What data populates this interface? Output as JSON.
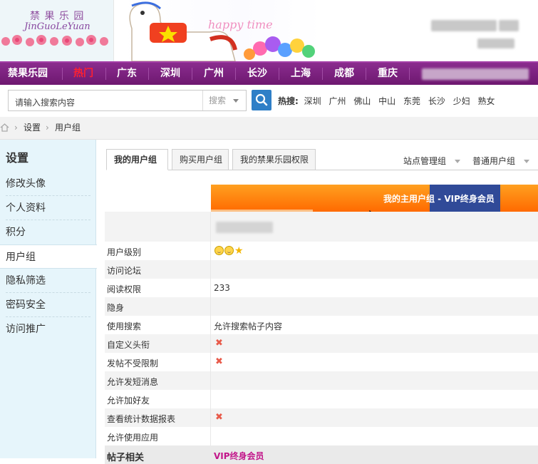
{
  "header": {
    "logo_cn": "禁 果 乐 园",
    "logo_en": "JinGuoLeYuan",
    "tagline": "happy time"
  },
  "nav": {
    "items": [
      "禁果乐园",
      "热门",
      "广东",
      "深圳",
      "广州",
      "长沙",
      "上海",
      "成都",
      "重庆"
    ],
    "hot_color": "#ff2030"
  },
  "search": {
    "placeholder": "请输入搜索内容",
    "type": "搜索",
    "hot_label": "热搜:",
    "hot_words": [
      "深圳",
      "广州",
      "佛山",
      "中山",
      "东莞",
      "长沙",
      "少妇",
      "熟女"
    ]
  },
  "breadcrumb": [
    "设置",
    "用户组"
  ],
  "sidebar": {
    "title": "设置",
    "items": [
      "修改头像",
      "个人资料",
      "积分",
      "用户组",
      "隐私筛选",
      "密码安全",
      "访问推广"
    ],
    "active": "用户组"
  },
  "tabs": {
    "items": [
      "我的用户组",
      "购买用户组",
      "我的禁果乐园权限"
    ],
    "active": "我的用户组",
    "right_dropdowns": [
      "站点管理组",
      "普通用户组"
    ]
  },
  "group": {
    "main_label": "我的主用户组 - VIP终身会员",
    "accent": "#ff7a10",
    "vip_color": "#304a98"
  },
  "permissions": [
    {
      "label": "用户级别",
      "value": "",
      "icon": "level"
    },
    {
      "label": "访问论坛",
      "value": ""
    },
    {
      "label": "阅读权限",
      "value": "233"
    },
    {
      "label": "隐身",
      "value": ""
    },
    {
      "label": "使用搜索",
      "value": "允许搜索帖子内容"
    },
    {
      "label": "自定义头衔",
      "value": "",
      "icon": "cross"
    },
    {
      "label": "发帖不受限制",
      "value": "",
      "icon": "cross"
    },
    {
      "label": "允许发短消息",
      "value": ""
    },
    {
      "label": "允许加好友",
      "value": ""
    },
    {
      "label": "查看统计数据报表",
      "value": "",
      "icon": "cross"
    },
    {
      "label": "允许使用应用",
      "value": ""
    }
  ],
  "section_footer": {
    "label": "帖子相关",
    "value": "VIP终身会员"
  }
}
